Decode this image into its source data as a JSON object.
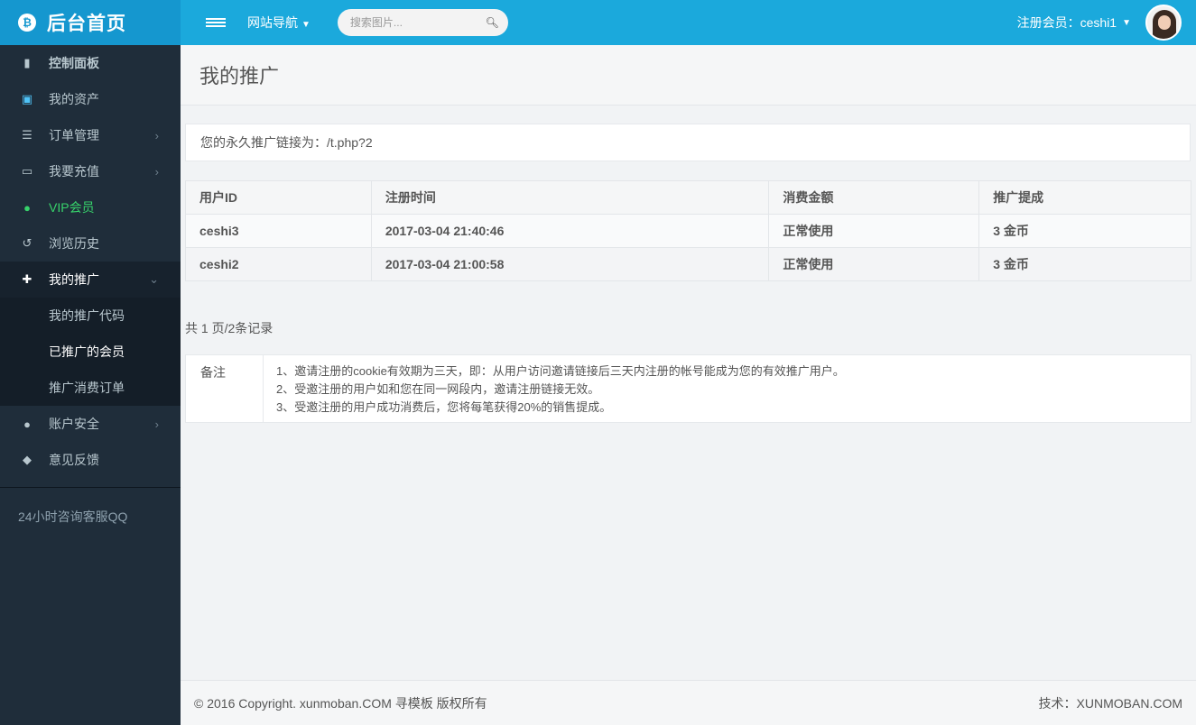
{
  "brand": {
    "logo_glyph": "₿",
    "title": "后台首页"
  },
  "header": {
    "nav_label": "网站导航",
    "search_placeholder": "搜索图片...",
    "user_label": "注册会员：ceshi1"
  },
  "sidebar": {
    "items": [
      {
        "label": "控制面板",
        "icon": "bar-chart-icon",
        "glyph": "▮"
      },
      {
        "label": "我的资产",
        "icon": "money-icon",
        "glyph": "▣"
      },
      {
        "label": "订单管理",
        "icon": "list-icon",
        "glyph": "☰"
      },
      {
        "label": "我要充值",
        "icon": "credit-card-icon",
        "glyph": "▭"
      },
      {
        "label": "VIP会员",
        "icon": "user-icon",
        "glyph": "●"
      },
      {
        "label": "浏览历史",
        "icon": "history-icon",
        "glyph": "↺"
      },
      {
        "label": "我的推广",
        "icon": "users-icon",
        "glyph": "✚"
      },
      {
        "label": "账户安全",
        "icon": "user-icon",
        "glyph": "●"
      },
      {
        "label": "意见反馈",
        "icon": "comment-icon",
        "glyph": "◆"
      }
    ],
    "submenu": [
      "我的推广代码",
      "已推广的会员",
      "推广消费订单"
    ],
    "footer_text": "24小时咨询客服QQ"
  },
  "page": {
    "title": "我的推广",
    "link_text": "您的永久推广链接为：/t.php?2",
    "table": {
      "headers": [
        "用户ID",
        "注册时间",
        "消费金额",
        "推广提成"
      ],
      "rows": [
        [
          "ceshi3",
          "2017-03-04 21:40:46",
          "正常使用",
          "3 金币"
        ],
        [
          "ceshi2",
          "2017-03-04 21:00:58",
          "正常使用",
          "3 金币"
        ]
      ]
    },
    "pager_text": "共 1 页/2条记录",
    "notes": {
      "label": "备注",
      "lines": [
        "1、邀请注册的cookie有效期为三天，即：从用户访问邀请链接后三天内注册的帐号能成为您的有效推广用户。",
        "2、受邀注册的用户如和您在同一网段内，邀请注册链接无效。",
        "3、受邀注册的用户成功消费后，您将每笔获得20%的销售提成。"
      ]
    }
  },
  "footer": {
    "copyright": "© 2016 Copyright. xunmoban.COM 寻模板 版权所有",
    "tech": "技术：XUNMOBAN.COM"
  },
  "colors": {
    "header": "#1ba9dc",
    "brand": "#1597cf",
    "sidebar": "#1f2d3a",
    "vip": "#37d36b"
  }
}
